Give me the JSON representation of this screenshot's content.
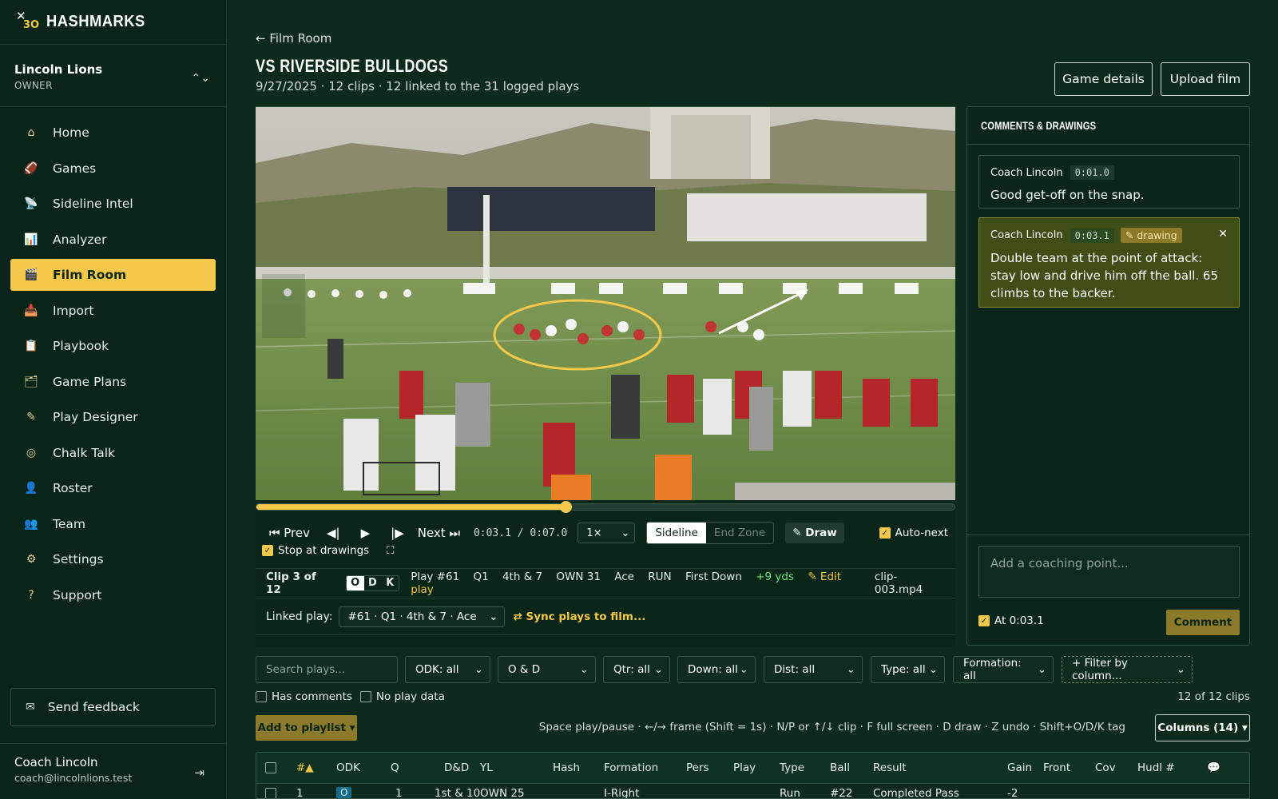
{
  "brand": {
    "name": "HASHMARKS"
  },
  "team": {
    "name": "Lincoln Lions",
    "role": "OWNER"
  },
  "nav": [
    {
      "label": "Home",
      "icon": "home-icon",
      "glyph": "⌂"
    },
    {
      "label": "Games",
      "icon": "football-icon",
      "glyph": "🏈"
    },
    {
      "label": "Sideline Intel",
      "icon": "satellite-icon",
      "glyph": "📡"
    },
    {
      "label": "Analyzer",
      "icon": "chart-icon",
      "glyph": "📊"
    },
    {
      "label": "Film Room",
      "icon": "clapper-icon",
      "glyph": "🎬"
    },
    {
      "label": "Import",
      "icon": "inbox-icon",
      "glyph": "📥"
    },
    {
      "label": "Playbook",
      "icon": "clipboard-icon",
      "glyph": "📋"
    },
    {
      "label": "Game Plans",
      "icon": "folder-icon",
      "glyph": "🗂"
    },
    {
      "label": "Play Designer",
      "icon": "pencil-icon",
      "glyph": "✎"
    },
    {
      "label": "Chalk Talk",
      "icon": "target-icon",
      "glyph": "◎"
    },
    {
      "label": "Roster",
      "icon": "person-icon",
      "glyph": "👤"
    },
    {
      "label": "Team",
      "icon": "people-icon",
      "glyph": "👥"
    },
    {
      "label": "Settings",
      "icon": "gear-icon",
      "glyph": "⚙"
    },
    {
      "label": "Support",
      "icon": "question-icon",
      "glyph": "?"
    }
  ],
  "feedback": {
    "label": "Send feedback"
  },
  "user": {
    "name": "Coach Lincoln",
    "email": "coach@lincolnlions.test"
  },
  "page": {
    "back": "← Film Room",
    "title": "VS RIVERSIDE BULLDOGS",
    "subtitle": "9/27/2025 · 12 clips · 12 linked to the 31 logged plays",
    "game_details": "Game details",
    "upload_film": "Upload film"
  },
  "player": {
    "progress": 0.443,
    "prev": "⏮ Prev",
    "next": "Next ⏭",
    "time": "0:03.1 / 0:07.0",
    "speed": "1×",
    "view_on": "Sideline",
    "view_off": "End Zone",
    "draw": "✎ Draw",
    "auto_next": "Auto-next",
    "stop_at_drawings": "Stop at drawings"
  },
  "clip": {
    "label": "Clip 3 of 12",
    "odk": [
      "O",
      "D",
      "K"
    ],
    "play": "Play #61",
    "qtr": "Q1",
    "down": "4th & 7",
    "yl": "OWN 31",
    "formation": "Ace",
    "type": "RUN",
    "result": "First Down",
    "gain": "+9 yds",
    "edit": "✎ Edit play",
    "file": "clip-003.mp4"
  },
  "linked": {
    "label": "Linked play:",
    "value": "#61 · Q1 · 4th & 7 · Ace",
    "sync": "⇄ Sync plays to film..."
  },
  "comments": {
    "heading": "COMMENTS & DRAWINGS",
    "items": [
      {
        "author": "Coach Lincoln",
        "time": "0:01.0",
        "text": "Good get-off on the snap."
      },
      {
        "author": "Coach Lincoln",
        "time": "0:03.1",
        "tag": "✎ drawing",
        "text": "Double team at the point of attack: stay low and drive him off the ball. 65 climbs to the backer."
      }
    ],
    "placeholder": "Add a coaching point...",
    "at_label": "At 0:03.1",
    "submit": "Comment"
  },
  "filters": {
    "search_placeholder": "Search plays...",
    "odk": "ODK: all",
    "side": "O & D",
    "qtr": "Qtr: all",
    "down": "Down: all",
    "dist": "Dist: all",
    "type": "Type: all",
    "formation": "Formation: all",
    "add_filter": "+ Filter by column...",
    "has_comments": "Has comments",
    "no_play_data": "No play data",
    "count": "12 of 12 clips"
  },
  "toolbar": {
    "playlist": "Add to playlist ▾",
    "shortcuts": "Space play/pause · ←/→ frame (Shift = 1s) · N/P or ↑/↓ clip · F full screen · D draw · Z undo · Shift+O/D/K tag",
    "columns": "Columns (14) ▾"
  },
  "table": {
    "headers": [
      "#▲",
      "ODK",
      "Q",
      "D&D",
      "YL",
      "Hash",
      "Formation",
      "Pers",
      "Play",
      "Type",
      "Ball",
      "Result",
      "Gain",
      "Front",
      "Cov",
      "Hudl #",
      "💬"
    ],
    "rows": [
      [
        "1",
        "O",
        "1",
        "1st & 10",
        "OWN 25",
        "",
        "I-Right",
        "",
        "",
        "Run",
        "#22",
        "Completed Pass",
        "-2",
        "",
        "",
        "",
        ""
      ]
    ]
  },
  "colors": {
    "accent": "#f3c84b",
    "background": "#0c2b1b",
    "sidebar": "#082517"
  }
}
